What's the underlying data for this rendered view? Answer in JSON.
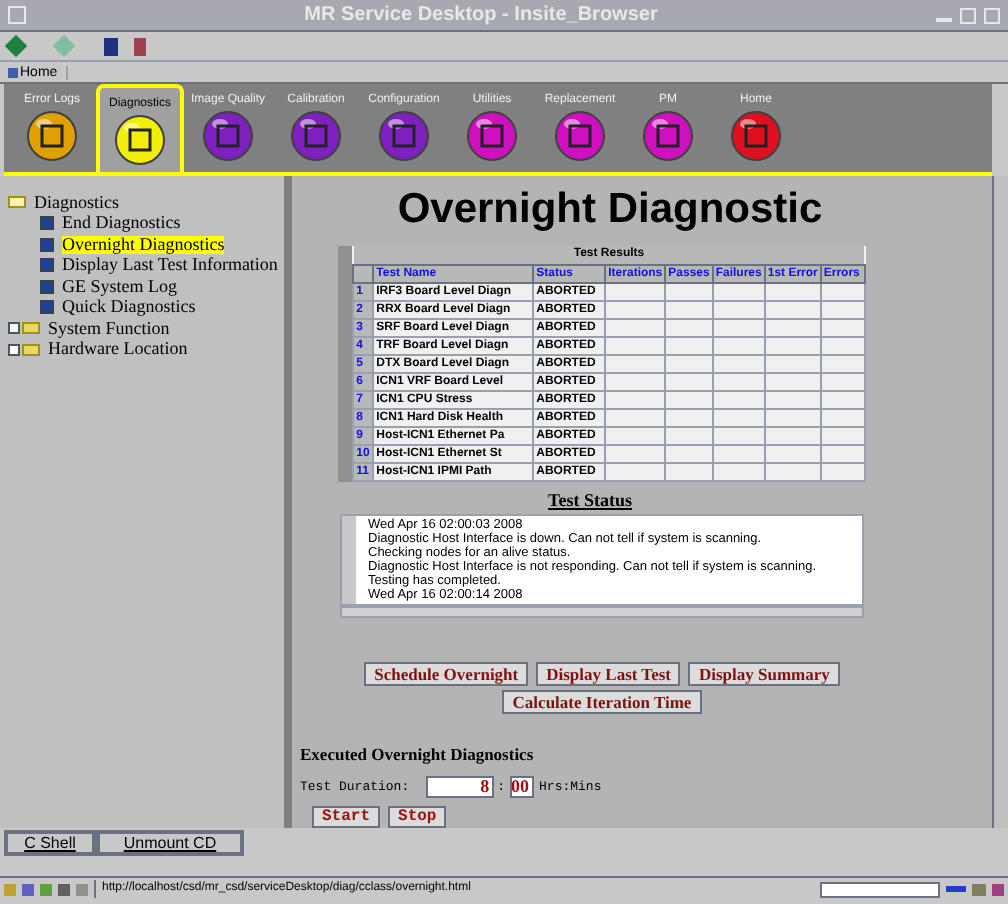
{
  "window": {
    "title": "MR Service Desktop - Insite_Browser"
  },
  "bookmarks": [
    {
      "label": "Home"
    }
  ],
  "tabs": [
    {
      "label": "Error Logs",
      "selected": false,
      "color": "#e0a000"
    },
    {
      "label": "Diagnostics",
      "selected": true,
      "color": "#f0f000"
    },
    {
      "label": "Image Quality",
      "selected": false,
      "color": "#8020c0"
    },
    {
      "label": "Calibration",
      "selected": false,
      "color": "#8020c0"
    },
    {
      "label": "Configuration",
      "selected": false,
      "color": "#8020c0"
    },
    {
      "label": "Utilities",
      "selected": false,
      "color": "#d010c0"
    },
    {
      "label": "Replacement",
      "selected": false,
      "color": "#d010c0"
    },
    {
      "label": "PM",
      "selected": false,
      "color": "#d010c0"
    },
    {
      "label": "Home",
      "selected": false,
      "color": "#e01020"
    }
  ],
  "tree": [
    {
      "label": "Diagnostics",
      "expanded": true,
      "children": [
        {
          "label": "End Diagnostics",
          "selected": false
        },
        {
          "label": "Overnight Diagnostics",
          "selected": true
        },
        {
          "label": "Display Last Test Information",
          "selected": false
        },
        {
          "label": "GE System Log",
          "selected": false
        },
        {
          "label": "Quick Diagnostics",
          "selected": false
        }
      ]
    },
    {
      "label": "System Function",
      "expanded": false
    },
    {
      "label": "Hardware Location",
      "expanded": false
    }
  ],
  "page_title": "Overnight Diagnostic",
  "results": {
    "caption": "Test Results",
    "columns": [
      "Test Name",
      "Status",
      "Iterations",
      "Passes",
      "Failures",
      "1st Error",
      "Errors"
    ],
    "rows": [
      {
        "num": "1",
        "name": "IRF3 Board Level Diagn",
        "status": "ABORTED"
      },
      {
        "num": "2",
        "name": "RRX Board Level Diagn",
        "status": "ABORTED"
      },
      {
        "num": "3",
        "name": "SRF Board Level Diagn",
        "status": "ABORTED"
      },
      {
        "num": "4",
        "name": "TRF Board Level Diagn",
        "status": "ABORTED"
      },
      {
        "num": "5",
        "name": "DTX Board Level Diagn",
        "status": "ABORTED"
      },
      {
        "num": "6",
        "name": "ICN1 VRF Board Level",
        "status": "ABORTED"
      },
      {
        "num": "7",
        "name": "ICN1 CPU Stress",
        "status": "ABORTED"
      },
      {
        "num": "8",
        "name": "ICN1 Hard Disk Health",
        "status": "ABORTED"
      },
      {
        "num": "9",
        "name": "Host-ICN1 Ethernet Pa",
        "status": "ABORTED"
      },
      {
        "num": "10",
        "name": "Host-ICN1 Ethernet St",
        "status": "ABORTED"
      },
      {
        "num": "11",
        "name": "Host-ICN1 IPMI Path",
        "status": "ABORTED"
      }
    ]
  },
  "status": {
    "heading": "Test Status",
    "lines": [
      "Wed Apr 16 02:00:03 2008",
      "Diagnostic Host Interface is down.  Can not tell if system is scanning.",
      "Checking nodes for an alive status.",
      "Diagnostic Host Interface is not responding.  Can not tell if system is scanning.",
      "Testing has completed.",
      "Wed Apr 16 02:00:14 2008"
    ]
  },
  "actions": [
    "Schedule Overnight",
    "Display Last Test",
    "Display Summary",
    "Calculate Iteration Time"
  ],
  "executed": {
    "heading": "Executed Overnight Diagnostics",
    "duration_label": "Test Duration:",
    "hours": "8",
    "separator": ":",
    "minutes": "00",
    "unit": "Hrs:Mins",
    "buttons": [
      "Start",
      "Stop"
    ]
  },
  "bottom_buttons": [
    "C Shell",
    "Unmount CD"
  ],
  "status_bar": {
    "url": "http://localhost/csd/mr_csd/serviceDesktop/diag/cclass/overnight.html"
  }
}
